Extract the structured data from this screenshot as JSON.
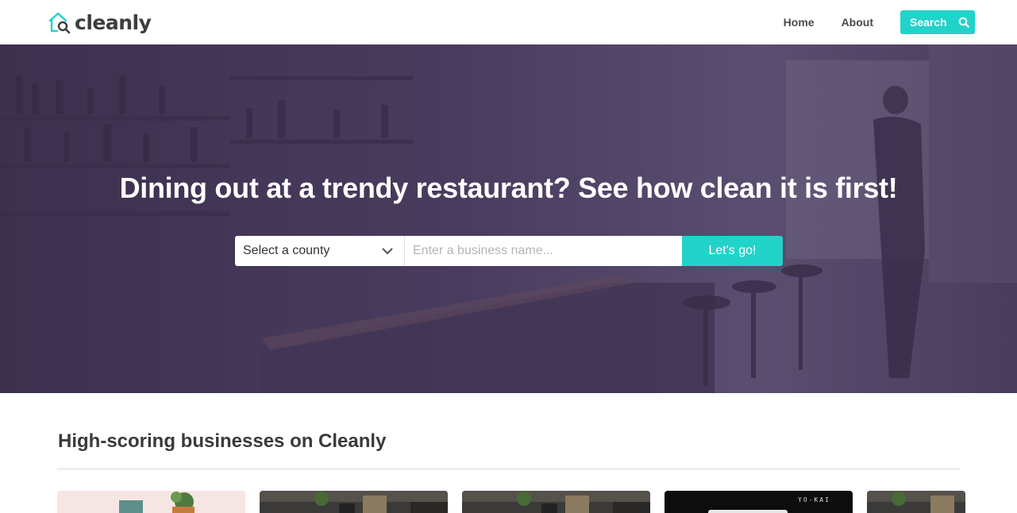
{
  "brand": {
    "name": "cleanly",
    "accent": "#22d3c9",
    "logo_icon": "house-magnifier-icon"
  },
  "nav": {
    "home": "Home",
    "about": "About",
    "search": "Search",
    "search_icon": "search-icon"
  },
  "hero": {
    "title": "Dining out at a trendy restaurant? See how clean it is first!",
    "county_select": "Select a county",
    "business_placeholder": "Enter a business name...",
    "submit": "Let's go!"
  },
  "section": {
    "title": "High-scoring businesses on Cleanly",
    "cards": [
      {
        "name": "business-card-1",
        "theme": "cafe"
      },
      {
        "name": "business-card-2",
        "theme": "bar"
      },
      {
        "name": "business-card-3",
        "theme": "bar"
      },
      {
        "name": "business-card-4",
        "theme": "yokai",
        "logo": "YO-KAI"
      },
      {
        "name": "business-card-5",
        "theme": "bar"
      }
    ]
  }
}
